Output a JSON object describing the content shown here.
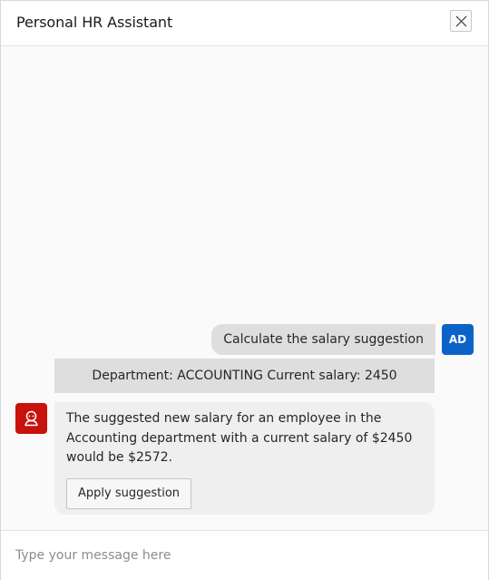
{
  "header": {
    "title": "Personal HR Assistant",
    "close_icon": "close-icon"
  },
  "messages": {
    "user_message": "Calculate the salary suggestion",
    "user_avatar_initials": "AD",
    "context": "Department: ACCOUNTING Current salary: 2450",
    "bot_avatar_icon": "assistant-bot-icon",
    "bot_reply": "The suggested new salary for an employee in the Accounting department with a current salary of $2450 would be $2572.",
    "apply_button_label": "Apply suggestion"
  },
  "composer": {
    "placeholder": "Type your message here",
    "value": ""
  },
  "colors": {
    "user_avatar_bg": "#0b63c8",
    "bot_avatar_bg": "#c8120c",
    "bubble_bg": "#dedede",
    "bot_bubble_bg": "#efefef"
  }
}
